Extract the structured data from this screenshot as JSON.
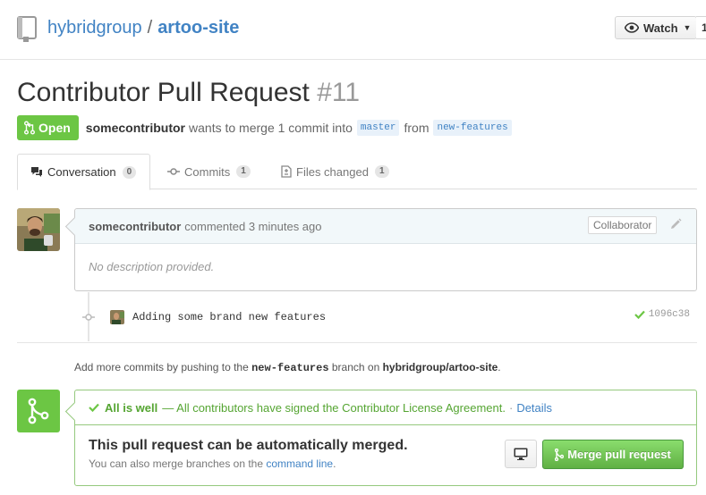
{
  "repo": {
    "owner": "hybridgroup",
    "separator": "/",
    "name": "artoo-site"
  },
  "watch": {
    "label": "Watch",
    "count": "1"
  },
  "pull_request": {
    "title": "Contributor Pull Request",
    "number": "#11",
    "state": "Open",
    "author": "somecontributor",
    "summary": "wants to merge 1 commit into",
    "base_branch": "master",
    "from_word": "from",
    "head_branch": "new-features"
  },
  "tabs": [
    {
      "label": "Conversation",
      "count": "0"
    },
    {
      "label": "Commits",
      "count": "1"
    },
    {
      "label": "Files changed",
      "count": "1"
    }
  ],
  "comment": {
    "author": "somecontributor",
    "action": "commented 3 minutes ago",
    "role": "Collaborator",
    "body": "No description provided."
  },
  "commit": {
    "message": "Adding some brand new features",
    "sha": "1096c38"
  },
  "push_hint": {
    "before": "Add more commits by pushing to the",
    "branch": "new-features",
    "middle": "branch on",
    "repo": "hybridgroup/artoo-site",
    "after": "."
  },
  "merge": {
    "status_title": "All is well",
    "status_text": "— All contributors have signed the Contributor License Agreement.",
    "dot": "·",
    "details_link": "Details",
    "heading": "This pull request can be automatically merged.",
    "sub_text": "You can also merge branches on the",
    "sub_link": "command line",
    "sub_end": ".",
    "button_label": "Merge pull request"
  },
  "colors": {
    "link": "#4183c4",
    "success": "#6cc644",
    "success_text": "#55a532"
  },
  "icons": [
    "repo-icon",
    "eye-icon",
    "pull-request-icon",
    "comment-icon",
    "commit-icon",
    "file-diff-icon",
    "pencil-icon",
    "check-icon",
    "merge-icon",
    "desktop-icon"
  ]
}
